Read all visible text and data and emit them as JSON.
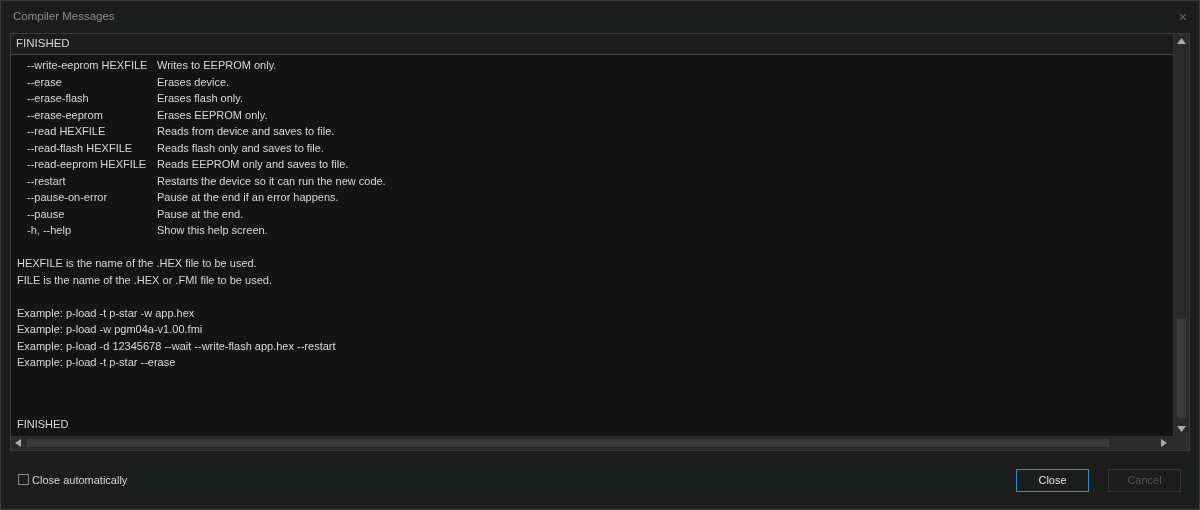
{
  "window": {
    "title": "Compiler Messages",
    "close": "×"
  },
  "output": {
    "header": "FINISHED",
    "options": [
      {
        "option": "--write-eeprom HEXFILE",
        "description": "Writes to EEPROM only."
      },
      {
        "option": "--erase",
        "description": "Erases device."
      },
      {
        "option": "--erase-flash",
        "description": "Erases flash only."
      },
      {
        "option": "--erase-eeprom",
        "description": "Erases EEPROM only."
      },
      {
        "option": "--read HEXFILE",
        "description": "Reads from device and saves to file."
      },
      {
        "option": "--read-flash HEXFILE",
        "description": "Reads flash only and saves to file."
      },
      {
        "option": "--read-eeprom HEXFILE",
        "description": "Reads EEPROM only and saves to file."
      },
      {
        "option": "--restart",
        "description": "Restarts the device so it can run the new code."
      },
      {
        "option": "--pause-on-error",
        "description": "Pause at the end if an error happens."
      },
      {
        "option": "--pause",
        "description": "Pause at the end."
      },
      {
        "option": "-h, --help",
        "description": "Show this help screen."
      }
    ],
    "notes": [
      "HEXFILE is the name of the .HEX file to be used.",
      "FILE is the name of the .HEX or .FMI file to be used."
    ],
    "examples": [
      "Example: p-load -t p-star -w app.hex",
      "Example: p-load -w pgm04a-v1.00.fmi",
      "Example: p-load -d 12345678 --wait --write-flash app.hex --restart",
      "Example: p-load -t p-star --erase"
    ],
    "footer": "FINISHED"
  },
  "close_automatically": {
    "label": "Close automatically",
    "checked": false
  },
  "buttons": [
    {
      "label": "Close",
      "focused": true,
      "disabled": false
    },
    {
      "label": "Cancel",
      "focused": false,
      "disabled": true
    }
  ]
}
